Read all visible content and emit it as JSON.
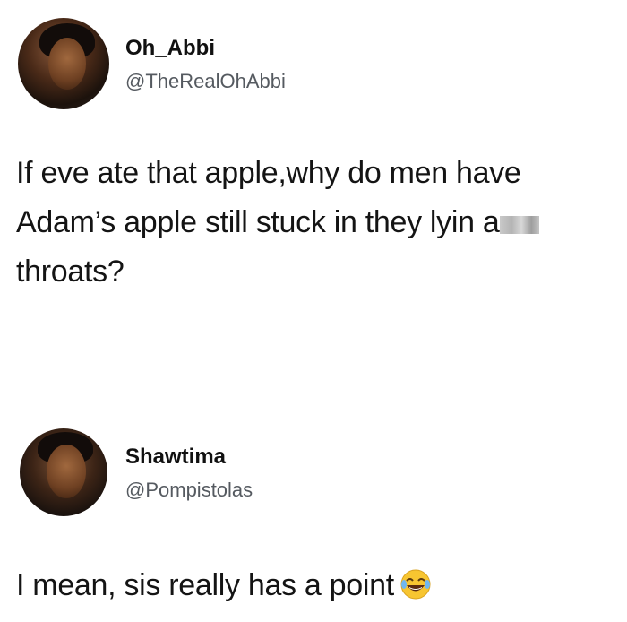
{
  "tweets": [
    {
      "display_name": "Oh_Abbi",
      "handle": "@TheRealOhAbbi",
      "text_line1": "If eve ate that apple,why do men have",
      "text_line2": "Adam’s apple still stuck in they lyin a",
      "text_line3": "throats?"
    },
    {
      "display_name": "Shawtima",
      "handle": "@Pompistolas",
      "text": "I mean, sis really has a point",
      "emoji_icon": "face-with-tears-of-joy-icon"
    }
  ],
  "colors": {
    "background": "#ffffff",
    "name_text": "#111111",
    "handle_text": "#555a60",
    "body_text": "#141414",
    "emoji_face": "#f7c531"
  }
}
